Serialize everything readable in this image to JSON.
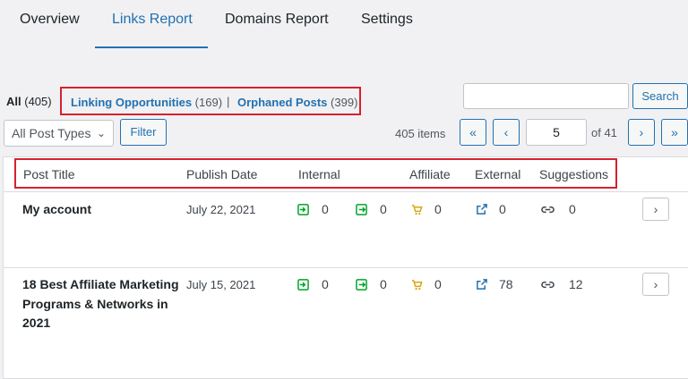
{
  "tabs": [
    {
      "label": "Overview"
    },
    {
      "label": "Links Report"
    },
    {
      "label": "Domains Report"
    },
    {
      "label": "Settings"
    }
  ],
  "filters": {
    "all_label": "All",
    "all_count": "(405)",
    "linking_label": "Linking Opportunities",
    "linking_count": "(169)",
    "separator": "|",
    "orphaned_label": "Orphaned Posts",
    "orphaned_count": "(399)"
  },
  "search": {
    "value": "",
    "button": "Search"
  },
  "post_type": {
    "selected": "All Post Types",
    "filter_button": "Filter"
  },
  "pagination": {
    "items_text": "405 items",
    "first": "«",
    "prev": "‹",
    "current_page": "5",
    "of_total": "of 41",
    "next": "›",
    "last": "»"
  },
  "table": {
    "columns": [
      "Post Title",
      "Publish Date",
      "Internal",
      "Affiliate",
      "External",
      "Suggestions"
    ],
    "rows": [
      {
        "title": "My account",
        "date": "July 22, 2021",
        "internal_in": "0",
        "internal_out": "0",
        "affiliate": "0",
        "external": "0",
        "suggestions": "0"
      },
      {
        "title": "18 Best Affiliate Marketing Programs & Networks in 2021",
        "date": "July 15, 2021",
        "internal_in": "0",
        "internal_out": "0",
        "affiliate": "0",
        "external": "78",
        "suggestions": "12"
      }
    ]
  },
  "colors": {
    "accent": "#2271b1",
    "highlight_box": "#d6212c",
    "inbound_icon": "#00a32a",
    "affiliate_icon": "#dba617"
  }
}
